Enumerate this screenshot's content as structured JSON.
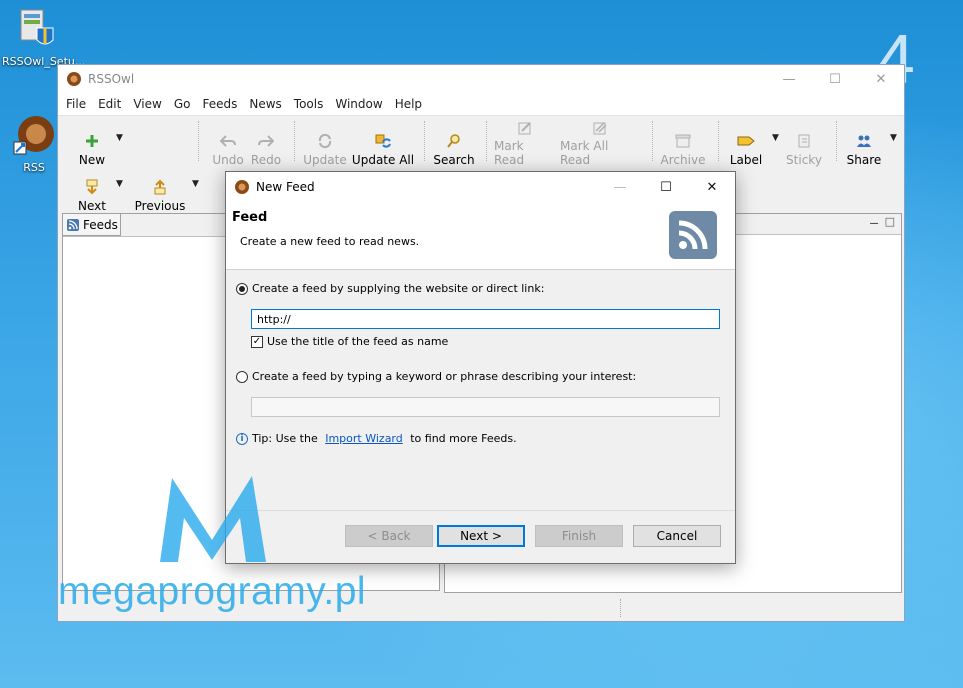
{
  "desktop": {
    "step_number": "4",
    "icons": [
      {
        "label": "RSSOwl_Setu..."
      },
      {
        "label": "RSS"
      }
    ]
  },
  "window": {
    "title": "RSSOwl",
    "menu": [
      "File",
      "Edit",
      "View",
      "Go",
      "Feeds",
      "News",
      "Tools",
      "Window",
      "Help"
    ],
    "toolbar": {
      "new": "New",
      "undo": "Undo",
      "redo": "Redo",
      "update": "Update",
      "update_all": "Update All",
      "search": "Search",
      "mark_read": "Mark Read",
      "mark_all_read": "Mark All Read",
      "archive": "Archive",
      "label": "Label",
      "sticky": "Sticky",
      "share": "Share",
      "next": "Next",
      "previous": "Previous"
    },
    "feeds_tab": "Feeds"
  },
  "dialog": {
    "title": "New Feed",
    "heading": "Feed",
    "subheading": "Create a new feed to read news.",
    "option_link": "Create a feed by supplying the website or direct link:",
    "url_value": "http://",
    "use_title_label": "Use the title of the feed as name",
    "use_title_checked": true,
    "option_keyword": "Create a feed by typing a keyword or phrase describing your interest:",
    "keyword_value": "",
    "tip_prefix": "Tip: Use the ",
    "tip_link": "Import Wizard",
    "tip_suffix": " to find more Feeds.",
    "buttons": {
      "back": "< Back",
      "next": "Next >",
      "finish": "Finish",
      "cancel": "Cancel"
    }
  },
  "watermark": {
    "text": "megaprogramy.pl"
  }
}
